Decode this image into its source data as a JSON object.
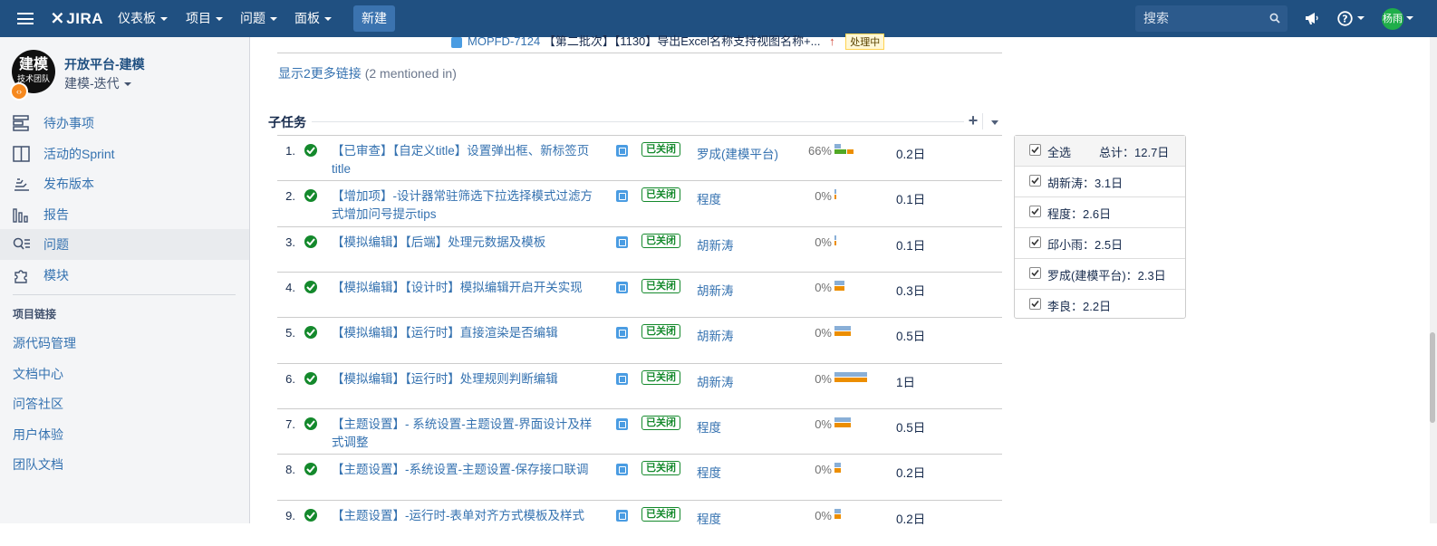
{
  "topbar": {
    "logo": "JIRA",
    "menus": [
      "仪表板",
      "项目",
      "问题",
      "面板"
    ],
    "create_label": "新建",
    "search_placeholder": "搜索",
    "user_initials": "杨雨",
    "icons": [
      "menu-icon",
      "megaphone-icon",
      "help-icon",
      "search-icon"
    ]
  },
  "sidebar": {
    "project_avatar_big": "建模",
    "project_avatar_small": "技术团队",
    "project_name": "开放平台-建模",
    "board_name": "建模-迭代",
    "nav": [
      {
        "label": "待办事项",
        "icon": "backlog-icon"
      },
      {
        "label": "活动的Sprint",
        "icon": "board-icon"
      },
      {
        "label": "发布版本",
        "icon": "release-icon"
      },
      {
        "label": "报告",
        "icon": "reports-icon"
      },
      {
        "label": "问题",
        "icon": "issues-icon",
        "active": true
      },
      {
        "label": "模块",
        "icon": "components-icon"
      }
    ],
    "links_title": "项目链接",
    "links": [
      "源代码管理",
      "文档中心",
      "问答社区",
      "用户体验",
      "团队文档"
    ]
  },
  "main": {
    "cut_row_key": "MOPFD-7124",
    "cut_row_text": "【第二批次】【1130】导出Excel名称支持视图名称+...",
    "cut_row_status": "处理中",
    "more_links": "显示2更多链接",
    "more_links_suffix": "(2 mentioned in)",
    "subtasks_title": "子任务",
    "subtasks": [
      {
        "num": "1.",
        "summary": "【已审查】【自定义title】设置弹出框、新标签页title",
        "status": "已关闭",
        "assignee": "罗成(建模平台)",
        "pct": "66%",
        "est": 0.12,
        "spent": 0.22,
        "rem": 0.12,
        "time": "0.2日"
      },
      {
        "num": "2.",
        "summary": "【增加项】-设计器常驻筛选下拉选择模式过滤方式增加问号提示tips",
        "status": "已关闭",
        "assignee": "程度",
        "pct": "0%",
        "est": 0.04,
        "spent": 0,
        "rem": 0.04,
        "time": "0.1日"
      },
      {
        "num": "3.",
        "summary": "【模拟编辑】【后端】处理元数据及模板",
        "status": "已关闭",
        "assignee": "胡新涛",
        "pct": "0%",
        "est": 0.04,
        "spent": 0,
        "rem": 0.04,
        "time": "0.1日"
      },
      {
        "num": "4.",
        "summary": "【模拟编辑】【设计时】模拟编辑开启开关实现",
        "status": "已关闭",
        "assignee": "胡新涛",
        "pct": "0%",
        "est": 0.18,
        "spent": 0,
        "rem": 0.18,
        "time": "0.3日"
      },
      {
        "num": "5.",
        "summary": "【模拟编辑】【运行时】直接渲染是否编辑",
        "status": "已关闭",
        "assignee": "胡新涛",
        "pct": "0%",
        "est": 0.3,
        "spent": 0,
        "rem": 0.3,
        "time": "0.5日"
      },
      {
        "num": "6.",
        "summary": "【模拟编辑】【运行时】处理规则判断编辑",
        "status": "已关闭",
        "assignee": "胡新涛",
        "pct": "0%",
        "est": 0.6,
        "spent": 0,
        "rem": 0.6,
        "time": "1日"
      },
      {
        "num": "7.",
        "summary": "【主题设置】- 系统设置-主题设置-界面设计及样式调整",
        "status": "已关闭",
        "assignee": "程度",
        "pct": "0%",
        "est": 0.3,
        "spent": 0,
        "rem": 0.3,
        "time": "0.5日"
      },
      {
        "num": "8.",
        "summary": "【主题设置】-系统设置-主题设置-保存接口联调",
        "status": "已关闭",
        "assignee": "程度",
        "pct": "0%",
        "est": 0.12,
        "spent": 0,
        "rem": 0.12,
        "time": "0.2日"
      },
      {
        "num": "9.",
        "summary": "【主题设置】-运行时-表单对齐方式模板及样式",
        "status": "已关闭",
        "assignee": "程度",
        "pct": "0%",
        "est": 0.12,
        "spent": 0,
        "rem": 0.12,
        "time": "0.2日"
      }
    ]
  },
  "filter_panel": {
    "select_all": "全选",
    "total": "总计：12.7日",
    "people": [
      "胡新涛：3.1日",
      "程度：2.6日",
      "邱小雨：2.5日",
      "罗成(建模平台)：2.3日",
      "李良：2.2日"
    ]
  },
  "colors": {
    "header": "#205081",
    "link": "#3572b0",
    "closed": "#14892c",
    "estimate_bar": "#89afd7",
    "remaining_bar": "#ec8e00",
    "logged_bar": "#51a825"
  }
}
